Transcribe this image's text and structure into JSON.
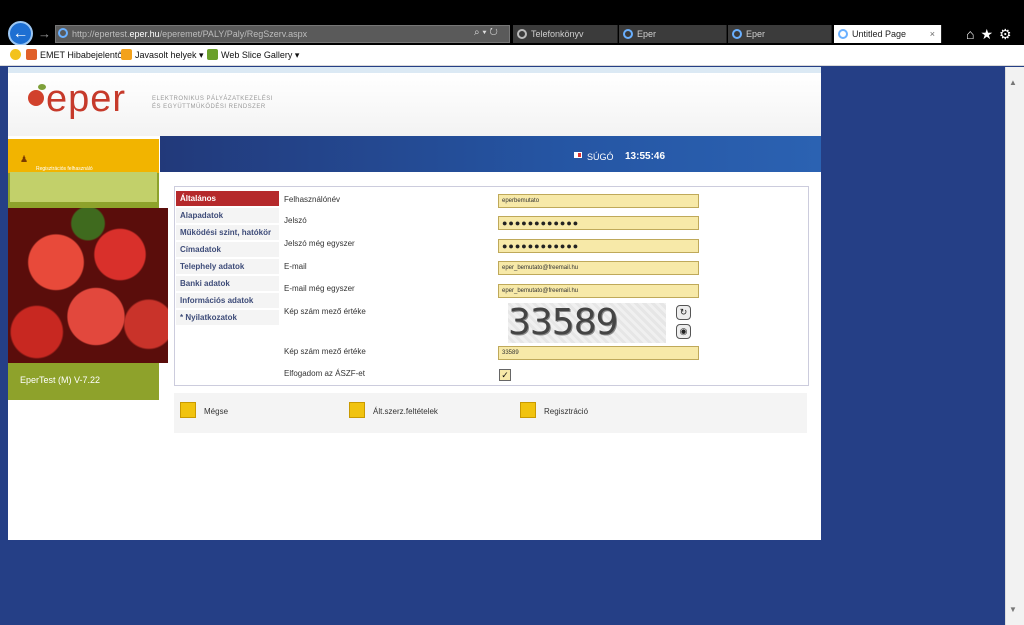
{
  "browser": {
    "address": {
      "prefix": "http://epertest.",
      "host": "eper.hu",
      "path": "/eperemet/PALY/Paly/RegSzerv.aspx"
    },
    "tabs": [
      {
        "label": "Telefonkönyv"
      },
      {
        "label": "Eper"
      },
      {
        "label": "Eper"
      },
      {
        "label": "Untitled Page"
      }
    ],
    "favorites": [
      {
        "label": "EMET Hibabejelentő"
      },
      {
        "label": "Javasolt helyek ▾"
      },
      {
        "label": "Web Slice Gallery ▾"
      }
    ]
  },
  "header": {
    "logo": "eper",
    "tagline_1": "ELEKTRONIKUS PÁLYÁZATKEZELÉSI",
    "tagline_2": "ÉS EGYÜTTMŰKÖDÉSI RENDSZER",
    "help": "SÚGÓ",
    "clock": "13:55:46"
  },
  "left_panel": {
    "user_label": "Regisztrációs felhasználó",
    "version": "EperTest (M) V-7.22"
  },
  "menu": [
    {
      "label": "Általános",
      "active": true
    },
    {
      "label": "Alapadatok"
    },
    {
      "label": "Működési szint, hatókör"
    },
    {
      "label": "Címadatok"
    },
    {
      "label": "Telephely adatok"
    },
    {
      "label": "Banki adatok"
    },
    {
      "label": "Információs adatok"
    },
    {
      "label": "* Nyilatkozatok"
    }
  ],
  "form": {
    "username_label": "Felhasználónév",
    "username_value": "eperbemutato",
    "password_label": "Jelszó",
    "password_value": "●●●●●●●●●●●●",
    "password2_label": "Jelszó még egyszer",
    "password2_value": "●●●●●●●●●●●●",
    "email_label": "E-mail",
    "email_value": "eper_bemutato@freemail.hu",
    "email2_label": "E-mail még egyszer",
    "email2_value": "eper_bemutato@freemail.hu",
    "captcha_label": "Kép szám mező értéke",
    "captcha_text": "33589",
    "captcha_input_label": "Kép szám mező értéke",
    "captcha_input_value": "33589",
    "terms_label": "Elfogadom az ÁSZF-et",
    "terms_checked": "✓"
  },
  "footer": {
    "cancel": "Mégse",
    "terms": "Ált.szerz.feltételek",
    "register": "Regisztráció"
  }
}
